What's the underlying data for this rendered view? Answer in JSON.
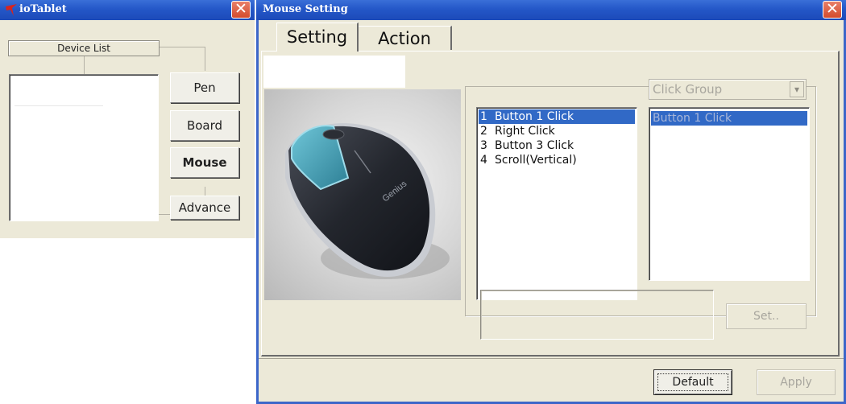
{
  "io_window": {
    "title": "ioTablet",
    "close_glyph": "✕",
    "device_list_label": "Device List",
    "buttons": {
      "pen": "Pen",
      "board": "Board",
      "mouse": "Mouse",
      "advance": "Advance"
    }
  },
  "mouse_window": {
    "title": "Mouse Setting",
    "close_glyph": "✕",
    "tabs": [
      {
        "label": "Setting",
        "active": true
      },
      {
        "label": "Action",
        "active": false
      }
    ],
    "button_list": [
      {
        "num": "1",
        "label": "Button 1 Click",
        "selected": true
      },
      {
        "num": "2",
        "label": "Right Click",
        "selected": false
      },
      {
        "num": "3",
        "label": "Button 3 Click",
        "selected": false
      },
      {
        "num": "4",
        "label": "Scroll(Vertical)",
        "selected": false
      }
    ],
    "group_select": {
      "value": "Click Group",
      "arrow": "▾"
    },
    "action_list": [
      {
        "label": "Button 1 Click",
        "selected": true
      }
    ],
    "set_button": "Set..",
    "default_button": "Default",
    "apply_button": "Apply"
  },
  "colors": {
    "titlebar": "#2457c8",
    "selection": "#3169c6",
    "dialog_bg": "#ece9d8",
    "disabled_text": "#a8a69e"
  },
  "icons": {
    "logo": "io-logo-icon",
    "close": "close-icon",
    "dropdown": "chevron-down-icon"
  }
}
